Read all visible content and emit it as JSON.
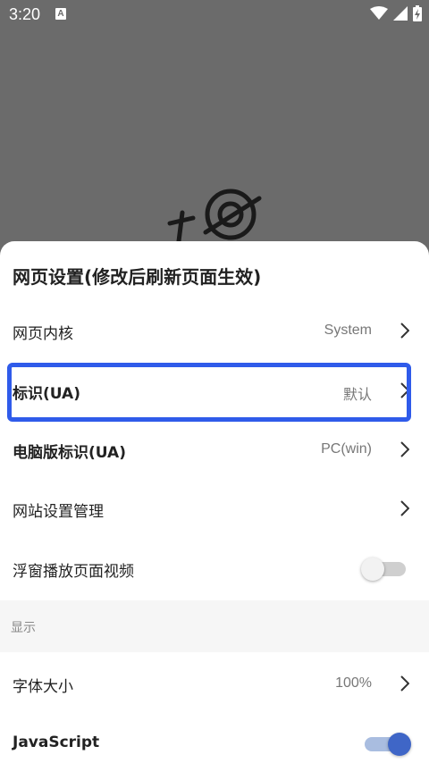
{
  "status_bar": {
    "time": "3:20",
    "notification_icon": "a-icon",
    "icons": [
      "wifi-icon",
      "signal-icon",
      "battery-charging-icon"
    ]
  },
  "sheet": {
    "title": "网页设置(修改后刷新页面生效)",
    "rows": [
      {
        "label": "网页内核",
        "value": "System"
      },
      {
        "label": "标识(UA)",
        "value": "默认"
      },
      {
        "label": "电脑版标识(UA)",
        "value": "PC(win)"
      },
      {
        "label": "网站设置管理"
      },
      {
        "label": "浮窗播放页面视频",
        "toggle": "off"
      }
    ],
    "section_header": "显示",
    "display_rows": [
      {
        "label": "字体大小",
        "value": "100%"
      },
      {
        "label": "JavaScript",
        "toggle": "on"
      }
    ]
  },
  "colors": {
    "highlight": "#2f5bea",
    "toggle_on": "#3f66c7"
  }
}
